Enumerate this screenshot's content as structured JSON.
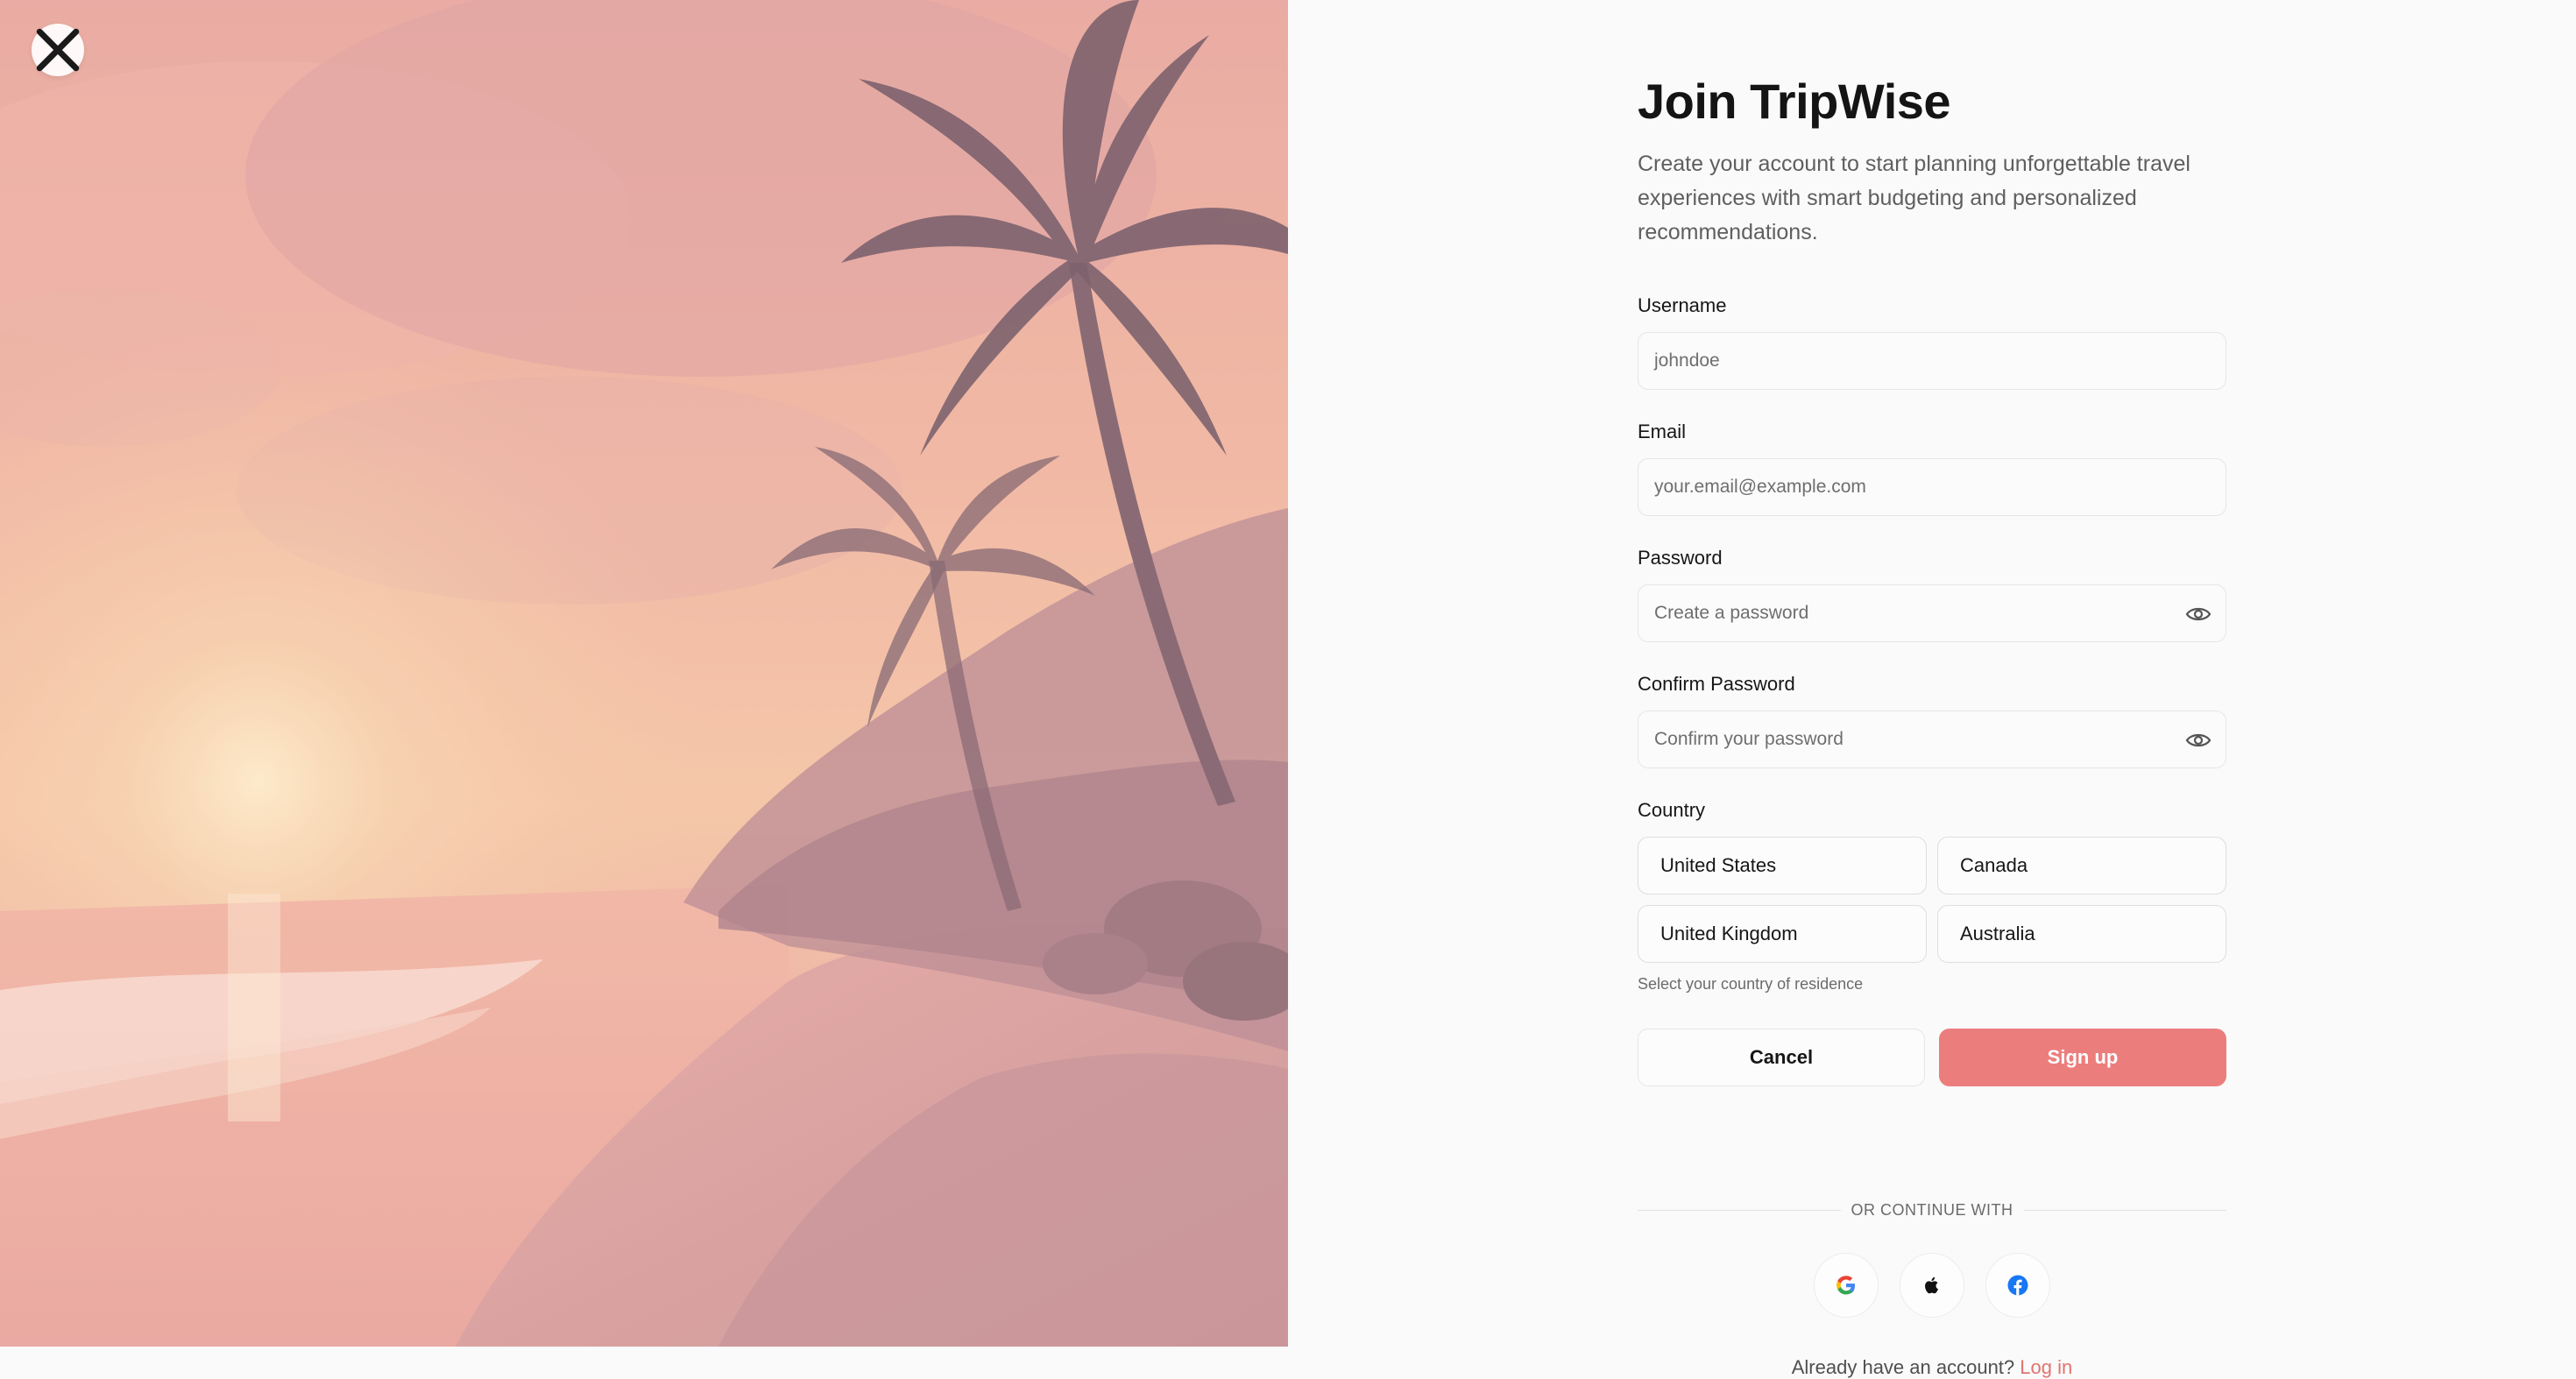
{
  "hero": {
    "image": "tropical-beach-sunset-illustration",
    "close_icon": "close-icon"
  },
  "form": {
    "title": "Join TripWise",
    "subtitle": "Create your account to start planning unforgettable travel experiences with smart budgeting and personalized recommendations.",
    "username": {
      "label": "Username",
      "placeholder": "johndoe"
    },
    "email": {
      "label": "Email",
      "placeholder": "your.email@example.com"
    },
    "password": {
      "label": "Password",
      "placeholder": "Create a password",
      "toggle_icon": "eye-icon"
    },
    "confirm_password": {
      "label": "Confirm Password",
      "placeholder": "Confirm your password",
      "toggle_icon": "eye-icon"
    },
    "country": {
      "label": "Country",
      "options": [
        "United States",
        "Canada",
        "United Kingdom",
        "Australia"
      ],
      "hint": "Select your country of residence"
    },
    "cancel_label": "Cancel",
    "signup_label": "Sign up",
    "divider_text": "OR CONTINUE WITH",
    "social_icons": [
      "google-icon",
      "apple-icon",
      "facebook-icon"
    ],
    "login_prompt": "Already have an account?",
    "login_link": "Log in"
  },
  "colors": {
    "accent": "#eb7e7d",
    "link": "#e0736f",
    "text": "#161616",
    "muted": "#5f5f5f",
    "facebook": "#1877f2"
  }
}
